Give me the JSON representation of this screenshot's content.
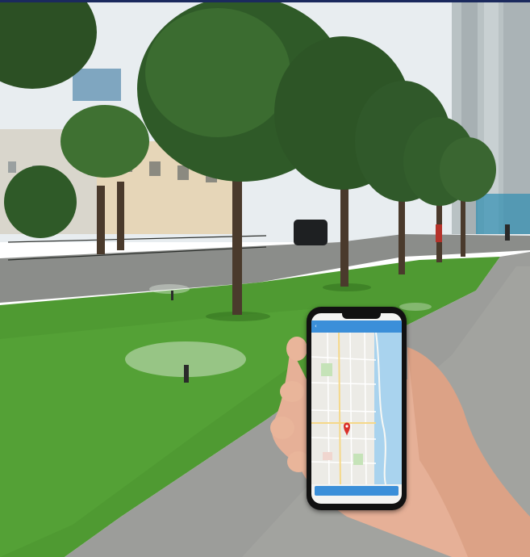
{
  "colors": {
    "banner": "#1b2a5e",
    "sky": "#e9eef0",
    "grass": "#4f9a32",
    "path": "#9c9d9a",
    "road": "#8a8c89",
    "app_accent": "#3b8fd9",
    "map_pin": "#d9302a",
    "skin": "#e9b59a"
  },
  "phone": {
    "status_time": "",
    "status_right": "",
    "app_bar_brand": "",
    "action_button_label": ""
  },
  "icons": [
    "back-arrow-icon",
    "map-pin-icon",
    "sprinkler-icon"
  ]
}
